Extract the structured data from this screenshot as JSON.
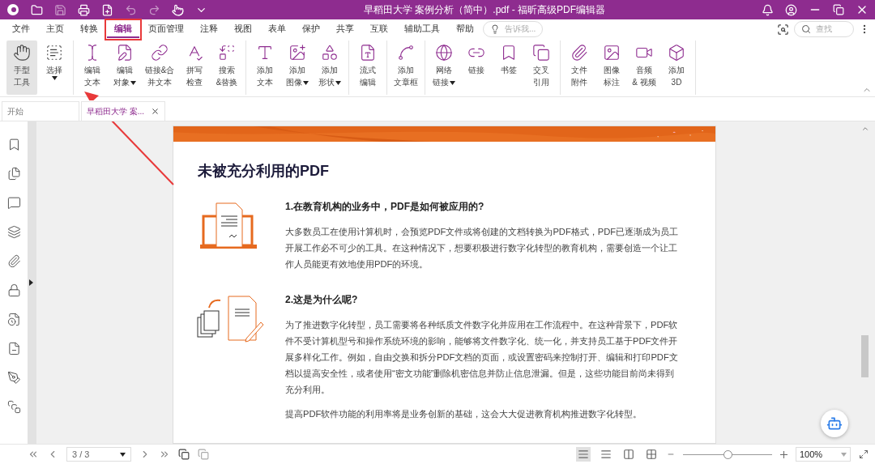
{
  "window": {
    "title": "早稻田大学 案例分析（简中）.pdf - 福昕高级PDF编辑器"
  },
  "menu_tabs": [
    {
      "label": "文件",
      "selected": false,
      "highlighted": false
    },
    {
      "label": "主页",
      "selected": false,
      "highlighted": false
    },
    {
      "label": "转换",
      "selected": false,
      "highlighted": false
    },
    {
      "label": "编辑",
      "selected": true,
      "highlighted": true
    },
    {
      "label": "页面管理",
      "selected": false,
      "highlighted": false
    },
    {
      "label": "注释",
      "selected": false,
      "highlighted": false
    },
    {
      "label": "视图",
      "selected": false,
      "highlighted": false
    },
    {
      "label": "表单",
      "selected": false,
      "highlighted": false
    },
    {
      "label": "保护",
      "selected": false,
      "highlighted": false
    },
    {
      "label": "共享",
      "selected": false,
      "highlighted": false
    },
    {
      "label": "互联",
      "selected": false,
      "highlighted": false
    },
    {
      "label": "辅助工具",
      "selected": false,
      "highlighted": false
    },
    {
      "label": "帮助",
      "selected": false,
      "highlighted": false
    }
  ],
  "tell_me": {
    "placeholder": "告诉我..."
  },
  "find": {
    "placeholder": "查找"
  },
  "ribbon": {
    "groups": [
      {
        "items": [
          {
            "lines": [
              "手型",
              "工具"
            ],
            "dropdown": false,
            "selected": true
          },
          {
            "lines": [
              "选择"
            ],
            "dropdown": true,
            "selected": false
          }
        ]
      },
      {
        "items": [
          {
            "lines": [
              "编辑",
              "文本"
            ],
            "dropdown": false,
            "selected": false
          },
          {
            "lines": [
              "编辑",
              "对象"
            ],
            "dropdown": true,
            "selected": false
          },
          {
            "lines": [
              "链接&合",
              "并文本"
            ],
            "dropdown": false,
            "selected": false
          },
          {
            "lines": [
              "拼写",
              "检查"
            ],
            "dropdown": false,
            "selected": false
          },
          {
            "lines": [
              "搜索",
              "&替换"
            ],
            "dropdown": false,
            "selected": false
          }
        ]
      },
      {
        "items": [
          {
            "lines": [
              "添加",
              "文本"
            ],
            "dropdown": false,
            "selected": false
          },
          {
            "lines": [
              "添加",
              "图像"
            ],
            "dropdown": true,
            "selected": false
          },
          {
            "lines": [
              "添加",
              "形状"
            ],
            "dropdown": true,
            "selected": false
          }
        ]
      },
      {
        "items": [
          {
            "lines": [
              "流式",
              "编辑"
            ],
            "dropdown": false,
            "selected": false
          }
        ]
      },
      {
        "items": [
          {
            "lines": [
              "添加",
              "文章框"
            ],
            "dropdown": false,
            "selected": false
          }
        ]
      },
      {
        "items": [
          {
            "lines": [
              "网络",
              "链接"
            ],
            "dropdown": true,
            "selected": false
          },
          {
            "lines": [
              "链接"
            ],
            "dropdown": false,
            "selected": false
          },
          {
            "lines": [
              "书签"
            ],
            "dropdown": false,
            "selected": false
          },
          {
            "lines": [
              "交叉",
              "引用"
            ],
            "dropdown": false,
            "selected": false
          }
        ]
      },
      {
        "items": [
          {
            "lines": [
              "文件",
              "附件"
            ],
            "dropdown": false,
            "selected": false
          },
          {
            "lines": [
              "图像",
              "标注"
            ],
            "dropdown": false,
            "selected": false
          },
          {
            "lines": [
              "音频",
              "& 视频"
            ],
            "dropdown": false,
            "selected": false
          },
          {
            "lines": [
              "添加",
              "3D"
            ],
            "dropdown": false,
            "selected": false
          }
        ]
      }
    ]
  },
  "doc_tabs": [
    {
      "label": "开始",
      "selected": false
    },
    {
      "label": "早稻田大学 案...",
      "selected": true
    }
  ],
  "document": {
    "title": "未被充分利用的PDF",
    "sections": [
      {
        "heading": "1.在教育机构的业务中，PDF是如何被应用的?",
        "paragraphs": [
          "大多数员工在使用计算机时，会预览PDF文件或将创建的文档转换为PDF格式，PDF已逐渐成为员工开展工作必不可少的工具。在这种情况下，想要积极进行数字化转型的教育机构，需要创造一个让工作人员能更有效地使用PDF的环境。"
        ]
      },
      {
        "heading": "2.这是为什么呢?",
        "paragraphs": [
          "为了推进数字化转型，员工需要将各种纸质文件数字化并应用在工作流程中。在这种背景下，PDF软件不受计算机型号和操作系统环境的影响，能够将文件数字化、统一化，并支持员工基于PDF文件开展多样化工作。例如，自由交换和拆分PDF文档的页面，或设置密码来控制打开、编辑和打印PDF文档以提高安全性，或者使用“密文功能”删除机密信息并防止信息泄漏。但是，这些功能目前尚未得到充分利用。",
          "提高PDF软件功能的利用率将是业务创新的基础，这会大大促进教育机构推进数字化转型。"
        ]
      }
    ]
  },
  "status_bar": {
    "page": "3 / 3",
    "view_modes": [
      {
        "selected": true
      },
      {
        "selected": false
      },
      {
        "selected": false
      },
      {
        "selected": false
      }
    ],
    "zoom": {
      "level": 0.5
    },
    "zoom_value": "100%"
  }
}
